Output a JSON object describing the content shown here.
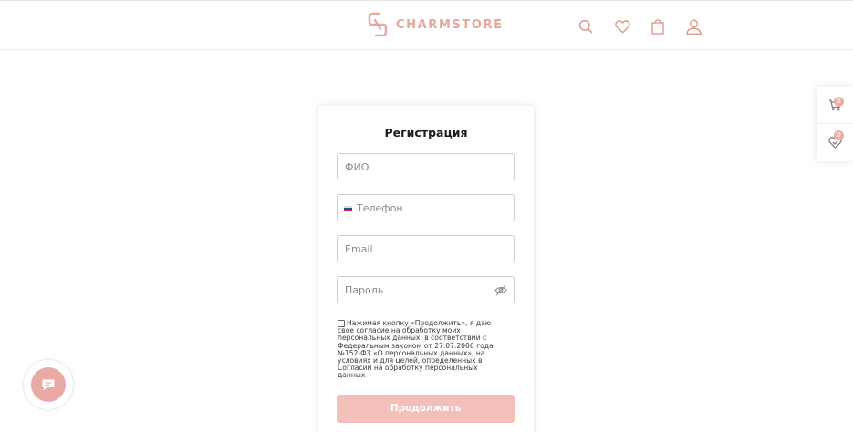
{
  "brand": {
    "name": "CHARMSTORE",
    "accent_color": "#e8a79e",
    "button_color": "#f2bfb9"
  },
  "header": {
    "icons": [
      "search-icon",
      "heart-icon",
      "shopping-bag-icon",
      "user-icon"
    ]
  },
  "side_panel": {
    "cart_count": "0",
    "favorites_count": "0"
  },
  "form": {
    "title": "Регистрация",
    "fields": {
      "name_placeholder": "ФИО",
      "phone_placeholder": "Телефон",
      "email_placeholder": "Email",
      "password_placeholder": "Пароль"
    },
    "consent_text": "Нажимая кнопку «Продолжить», я даю свое согласие на обработку моих персональных данных, в соответствии с Федеральным законом от 27.07.2006 года №152-ФЗ «О персональных данных», на условиях и для целей, определенных в Согласии на обработку персональных данных",
    "submit_label": "Продолжить"
  }
}
